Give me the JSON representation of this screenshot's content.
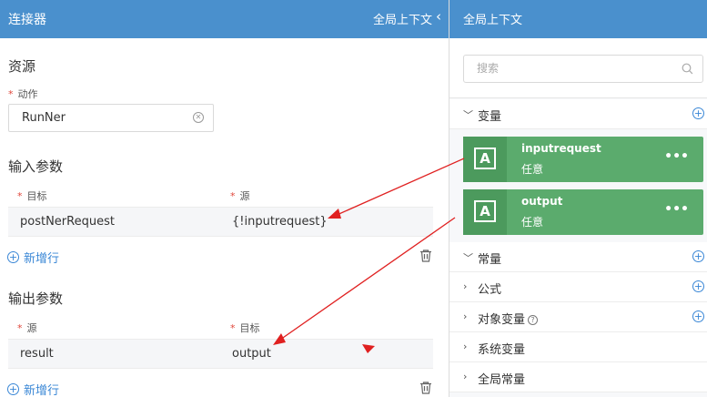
{
  "left_header": {
    "title": "连接器",
    "context_label": "全局上下文",
    "collapse_glyph": "‹"
  },
  "resources": {
    "title": "资源",
    "action": {
      "label": "动作",
      "value": "RunNer"
    }
  },
  "input_params": {
    "title": "输入参数",
    "headers": {
      "target": "目标",
      "source": "源"
    },
    "row": {
      "target": "postNerRequest",
      "source": "{!inputrequest}"
    },
    "add_label": "新增行"
  },
  "output_params": {
    "title": "输出参数",
    "headers": {
      "source": "源",
      "target": "目标"
    },
    "row": {
      "source": "result",
      "target": "output"
    },
    "add_label": "新增行"
  },
  "right_panel": {
    "title": "全局上下文",
    "search": {
      "placeholder": "搜索",
      "icon": "search-icon"
    },
    "variables": {
      "label": "变量",
      "items": [
        {
          "name": "inputrequest",
          "type": "任意",
          "icon": "variable-icon"
        },
        {
          "name": "output",
          "type": "任意",
          "icon": "variable-icon"
        }
      ]
    },
    "groups": [
      {
        "label": "常量",
        "addable": true,
        "info": false
      },
      {
        "label": "公式",
        "addable": true,
        "info": false
      },
      {
        "label": "对象变量",
        "addable": true,
        "info": true
      },
      {
        "label": "系统变量",
        "addable": false,
        "info": false
      },
      {
        "label": "全局常量",
        "addable": false,
        "info": false
      }
    ]
  },
  "colors": {
    "header_blue": "#4a90cd",
    "link_blue": "#3a87d6",
    "card_green": "#5bab6d",
    "required_red": "#e0473b",
    "arrow_red": "#e02020"
  }
}
